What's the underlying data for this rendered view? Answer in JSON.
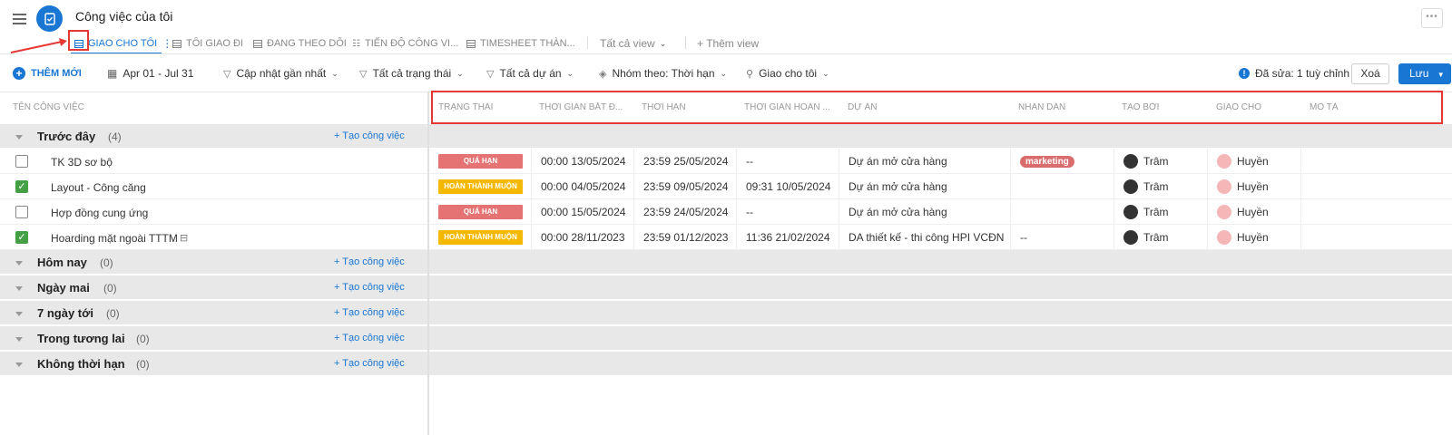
{
  "header": {
    "title": "Công việc của tôi"
  },
  "tabs": [
    {
      "label": "GIAO CHO TÔI"
    },
    {
      "label": "TÔI GIAO ĐI"
    },
    {
      "label": "ĐANG THEO DÕI"
    },
    {
      "label": "TIẾN ĐỘ CÔNG VI..."
    },
    {
      "label": "TIMESHEET THÀN..."
    }
  ],
  "tab_all_view": "Tất cả view",
  "tab_add_view": "+ Thêm view",
  "toolbar": {
    "add_new": "THÊM MỚI",
    "date_range": "Apr 01 - Jul 31",
    "sort": "Cập nhật gần nhất",
    "status_filter": "Tất cả trạng thái",
    "project_filter": "Tất cả dự án",
    "group_by": "Nhóm theo: Thời hạn",
    "assigned": "Giao cho tôi",
    "edited_note": "Đã sửa: 1 tuỳ chỉnh",
    "delete_label": "Xoá",
    "save_label": "Lưu"
  },
  "left_header": "TÊN CÔNG VIỆC",
  "add_task_label": "+ Tạo công việc",
  "groups": [
    {
      "name": "Trước đây",
      "count": "(4)"
    },
    {
      "name": "Hôm nay",
      "count": "(0)"
    },
    {
      "name": "Ngày mai",
      "count": "(0)"
    },
    {
      "name": "7 ngày tới",
      "count": "(0)"
    },
    {
      "name": "Trong tương lai",
      "count": "(0)"
    },
    {
      "name": "Không thời hạn",
      "count": "(0)"
    }
  ],
  "columns": [
    "TRẠNG THÁI",
    "THỜI GIAN BẮT Đ...",
    "THỜI HẠN",
    "THỜI GIAN HOÀN ...",
    "DỰ ÁN",
    "NHÃN DÁN",
    "TẠO BỞI",
    "GIAO CHO",
    "MÔ TẢ"
  ],
  "tasks": [
    {
      "name": "TK 3D sơ bộ",
      "checked": false,
      "status": "QUÁ HẠN",
      "status_color": "#e57373",
      "start": "00:00 13/05/2024",
      "deadline": "23:59 25/05/2024",
      "completed": "--",
      "project": "Dự án mở cửa hàng",
      "tag": "marketing",
      "creator": "Trâm",
      "assignee": "Huyền"
    },
    {
      "name": "Layout - Công căng",
      "checked": true,
      "status": "HOÀN THÀNH MUỘN",
      "status_color": "#f5b800",
      "start": "00:00 04/05/2024",
      "deadline": "23:59 09/05/2024",
      "completed": "09:31 10/05/2024",
      "project": "Dự án mở cửa hàng",
      "tag": "",
      "creator": "Trâm",
      "assignee": "Huyền"
    },
    {
      "name": "Hợp đồng cung ứng",
      "checked": false,
      "status": "QUÁ HẠN",
      "status_color": "#e57373",
      "start": "00:00 15/05/2024",
      "deadline": "23:59 24/05/2024",
      "completed": "--",
      "project": "Dự án mở cửa hàng",
      "tag": "",
      "creator": "Trâm",
      "assignee": "Huyền"
    },
    {
      "name": "Hoarding mặt ngoài TTTM",
      "checked": true,
      "status": "HOÀN THÀNH MUỘN",
      "status_color": "#f5b800",
      "start": "00:00 28/11/2023",
      "deadline": "23:59 01/12/2023",
      "completed": "11:36 21/02/2024",
      "project": "DA thiết kế - thi công HPI VCĐN",
      "tag": "--",
      "creator": "Trâm",
      "assignee": "Huyền"
    }
  ],
  "colors": {
    "accent": "#1976d2",
    "annotation": "#e53935",
    "overdue": "#e57373",
    "late_done": "#f5b800",
    "tag": "#d96c6c"
  }
}
